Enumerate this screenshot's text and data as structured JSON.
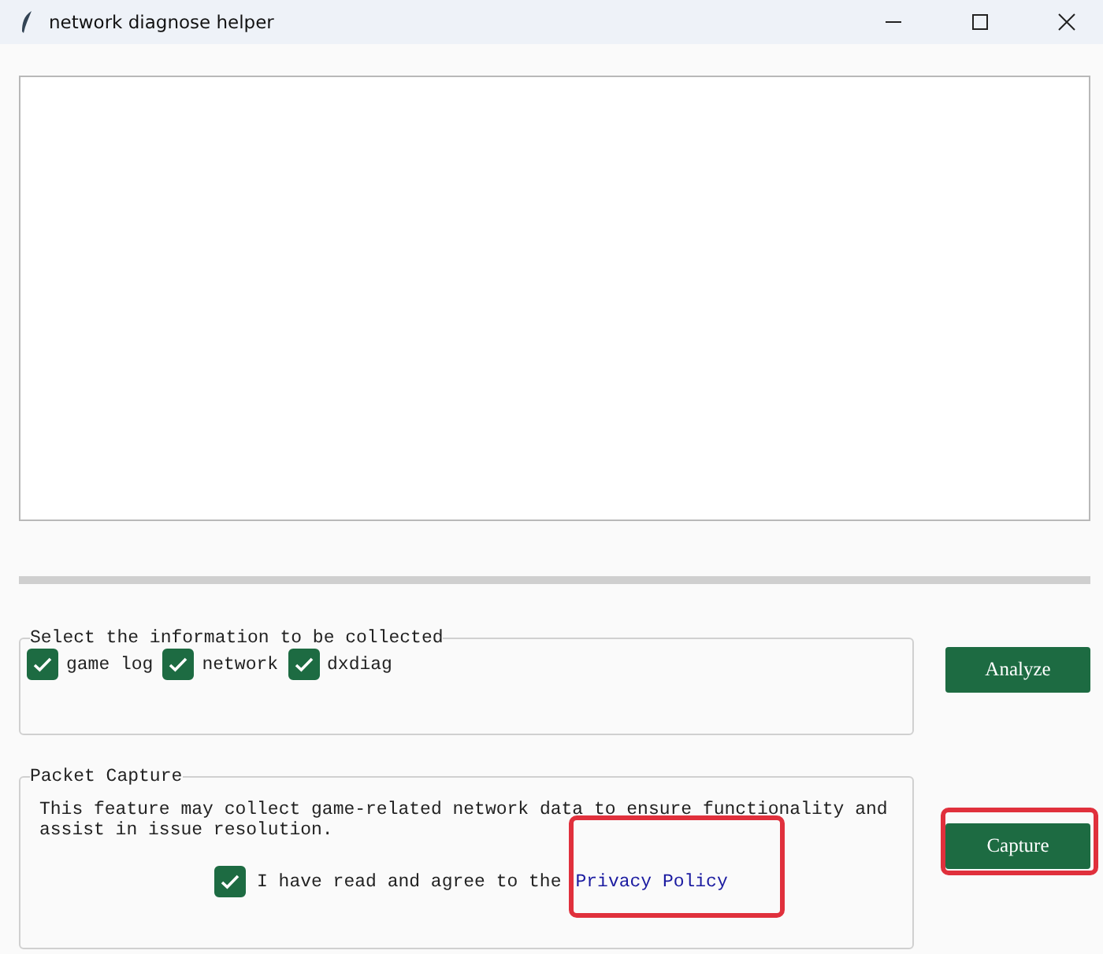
{
  "window": {
    "title": "network diagnose helper"
  },
  "collect_group": {
    "title": "Select the information to be collected",
    "options": [
      {
        "label": "game log",
        "checked": true
      },
      {
        "label": "network",
        "checked": true
      },
      {
        "label": "dxdiag",
        "checked": true
      }
    ],
    "button": {
      "label": "Analyze"
    }
  },
  "capture_group": {
    "title": "Packet Capture",
    "description": "This feature may collect game-related network data to ensure functionality and assist in issue resolution.",
    "agree": {
      "checked": true,
      "label": "I have read and agree to the",
      "link": {
        "label": "Privacy Policy",
        "highlighted": true
      }
    },
    "button": {
      "label": "Capture",
      "highlighted": true
    }
  }
}
